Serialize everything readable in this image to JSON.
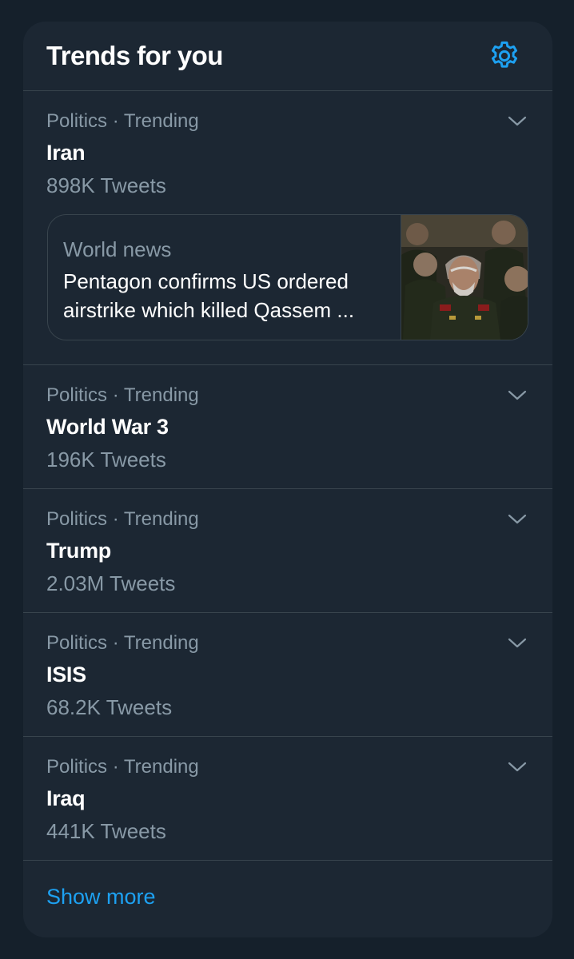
{
  "header": {
    "title": "Trends for you",
    "settings_icon": "gear-icon"
  },
  "accent_color": "#1da1f2",
  "trends": [
    {
      "meta": "Politics · Trending",
      "name": "Iran",
      "count": "898K Tweets",
      "news": {
        "source": "World news",
        "headline": "Pentagon confirms US ordered airstrike which killed Qassem ..."
      }
    },
    {
      "meta": "Politics · Trending",
      "name": "World War 3",
      "count": "196K Tweets"
    },
    {
      "meta": "Politics · Trending",
      "name": "Trump",
      "count": "2.03M Tweets"
    },
    {
      "meta": "Politics · Trending",
      "name": "ISIS",
      "count": "68.2K Tweets"
    },
    {
      "meta": "Politics · Trending",
      "name": "Iraq",
      "count": "441K Tweets"
    }
  ],
  "footer": {
    "show_more": "Show more"
  }
}
